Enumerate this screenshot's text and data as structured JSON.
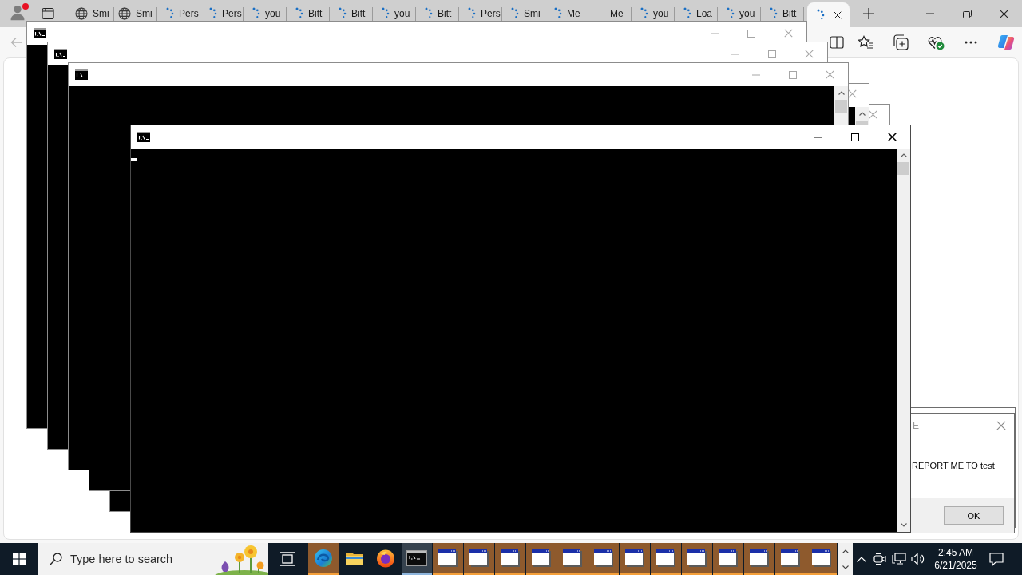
{
  "browser": {
    "profile": {
      "notification": true
    },
    "tabs": [
      {
        "kind": "globe",
        "label": "Smi",
        "selected": false
      },
      {
        "kind": "globe",
        "label": "Smi",
        "selected": false
      },
      {
        "kind": "loading",
        "label": "Pers",
        "selected": false
      },
      {
        "kind": "loading",
        "label": "Pers",
        "selected": false
      },
      {
        "kind": "loading",
        "label": "you",
        "selected": false
      },
      {
        "kind": "loading",
        "label": "Bitt",
        "selected": false
      },
      {
        "kind": "loading",
        "label": "Bitt",
        "selected": false
      },
      {
        "kind": "loading",
        "label": "you",
        "selected": false
      },
      {
        "kind": "loading",
        "label": "Bitt",
        "selected": false
      },
      {
        "kind": "loading",
        "label": "Pers",
        "selected": false
      },
      {
        "kind": "loading",
        "label": "Smi",
        "selected": false
      },
      {
        "kind": "loading",
        "label": "Me",
        "selected": false
      },
      {
        "kind": "blank",
        "label": "Me",
        "selected": false
      },
      {
        "kind": "loading",
        "label": "you",
        "selected": false
      },
      {
        "kind": "loading",
        "label": "Loa",
        "selected": false
      },
      {
        "kind": "loading",
        "label": "you",
        "selected": false
      },
      {
        "kind": "loading",
        "label": "Bitt",
        "selected": false
      },
      {
        "kind": "loading",
        "selected": true
      }
    ],
    "back": {
      "disabled": true
    }
  },
  "dialogs": [
    {
      "kind": "frame"
    },
    {
      "kind": "message",
      "active": false,
      "title": "E",
      "message": "REPORT ME TO test",
      "button": "OK"
    }
  ],
  "consoles": [
    {
      "active": false
    },
    {
      "active": false
    },
    {
      "active": false
    },
    {
      "active": false
    },
    {
      "active": false
    },
    {
      "active": true
    }
  ],
  "taskbar": {
    "search": {
      "placeholder": "Type here to search"
    },
    "apps": [
      {
        "kind": "edge",
        "flashing": true,
        "active": false
      },
      {
        "kind": "explorer",
        "flashing": false,
        "active": false
      },
      {
        "kind": "firefox",
        "flashing": false,
        "active": false
      },
      {
        "kind": "console",
        "flashing": false,
        "active": true
      },
      {
        "kind": "window",
        "flashing": true,
        "active": false
      },
      {
        "kind": "window",
        "flashing": true,
        "active": false
      },
      {
        "kind": "window",
        "flashing": true,
        "active": false
      },
      {
        "kind": "window",
        "flashing": true,
        "active": false
      },
      {
        "kind": "window",
        "flashing": true,
        "active": false
      },
      {
        "kind": "window",
        "flashing": true,
        "active": false
      },
      {
        "kind": "window",
        "flashing": true,
        "active": false
      },
      {
        "kind": "window",
        "flashing": true,
        "active": false
      },
      {
        "kind": "window",
        "flashing": true,
        "active": false
      },
      {
        "kind": "window",
        "flashing": true,
        "active": false
      },
      {
        "kind": "window",
        "flashing": true,
        "active": false
      },
      {
        "kind": "window",
        "flashing": true,
        "active": false
      },
      {
        "kind": "window",
        "flashing": true,
        "active": false
      }
    ],
    "clock": {
      "time": "2:45 AM",
      "date": "6/21/2025"
    }
  }
}
